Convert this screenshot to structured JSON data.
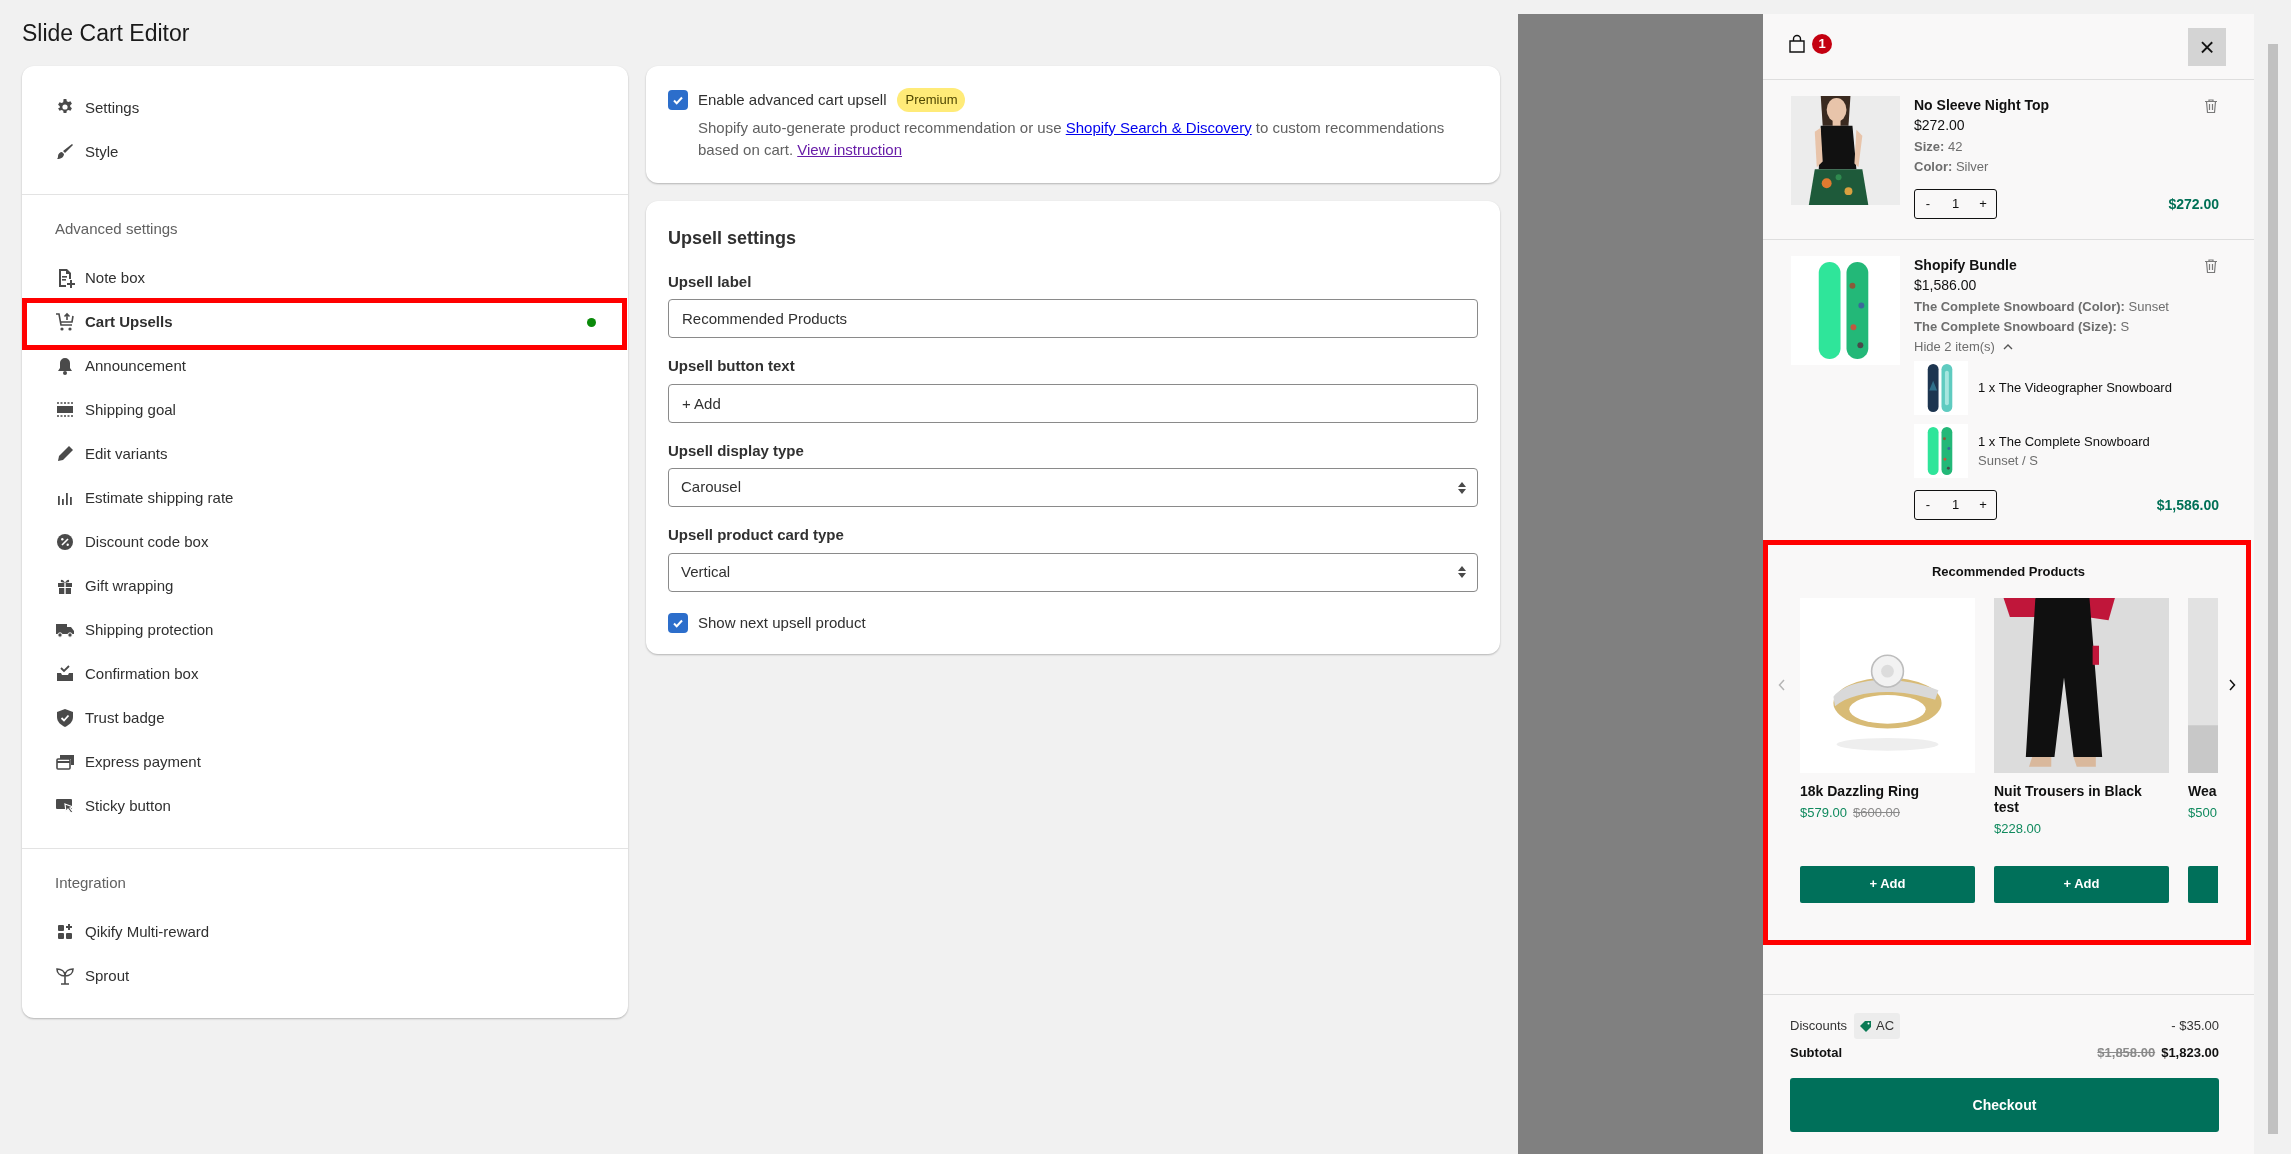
{
  "page_title": "Slide Cart Editor",
  "sidebar": {
    "sections": [
      {
        "items": [
          {
            "label": "Settings",
            "selected": false,
            "highlighted": false
          },
          {
            "label": "Style",
            "selected": false,
            "highlighted": false
          }
        ]
      },
      {
        "heading": "Advanced settings",
        "items": [
          {
            "label": "Note box",
            "selected": false,
            "highlighted": false
          },
          {
            "label": "Cart Upsells",
            "selected": true,
            "highlighted": true
          },
          {
            "label": "Announcement",
            "selected": false,
            "highlighted": false
          },
          {
            "label": "Shipping goal",
            "selected": false,
            "highlighted": false
          },
          {
            "label": "Edit variants",
            "selected": false,
            "highlighted": false
          },
          {
            "label": "Estimate shipping rate",
            "selected": false,
            "highlighted": false
          },
          {
            "label": "Discount code box",
            "selected": false,
            "highlighted": false
          },
          {
            "label": "Gift wrapping",
            "selected": false,
            "highlighted": false
          },
          {
            "label": "Shipping protection",
            "selected": false,
            "highlighted": false
          },
          {
            "label": "Confirmation box",
            "selected": false,
            "highlighted": false
          },
          {
            "label": "Trust badge",
            "selected": false,
            "highlighted": false
          },
          {
            "label": "Express payment",
            "selected": false,
            "highlighted": false
          },
          {
            "label": "Sticky button",
            "selected": false,
            "highlighted": false
          }
        ]
      },
      {
        "heading": "Integration",
        "items": [
          {
            "label": "Qikify Multi-reward",
            "selected": false,
            "highlighted": false
          },
          {
            "label": "Sprout",
            "selected": false,
            "highlighted": false
          }
        ]
      }
    ]
  },
  "enable_card": {
    "checkbox": {
      "label": "Enable advanced cart upsell",
      "checked": true
    },
    "badge": "Premium",
    "description": [
      {
        "kind": "text",
        "text": "Shopify auto-generate product recommendation or use "
      },
      {
        "kind": "link",
        "text": "Shopify Search & Discovery",
        "visited": false
      },
      {
        "kind": "text",
        "text": " to custom recommendations based on cart. "
      },
      {
        "kind": "link",
        "text": "View instruction",
        "visited": true
      }
    ]
  },
  "upsell_settings": {
    "title": "Upsell settings",
    "fields": [
      {
        "kind": "text",
        "label": "Upsell label",
        "value": "Recommended Products"
      },
      {
        "kind": "text",
        "label": "Upsell button text",
        "value": "+ Add"
      },
      {
        "kind": "select",
        "label": "Upsell display type",
        "value": "Carousel"
      },
      {
        "kind": "select",
        "label": "Upsell product card type",
        "value": "Vertical"
      }
    ],
    "checkbox": {
      "label": "Show next upsell product",
      "checked": true
    }
  },
  "cart": {
    "count": "1",
    "close": "×",
    "items": [
      {
        "name": "No Sleeve Night Top",
        "price": "$272.00",
        "options": [
          {
            "name": "Size:",
            "value": "42"
          },
          {
            "name": "Color:",
            "value": "Silver"
          }
        ],
        "quantity": "1",
        "decrement": "-",
        "increment": "+",
        "line_total": "$272.00"
      },
      {
        "name": "Shopify Bundle",
        "price": "$1,586.00",
        "options": [
          {
            "name": "The Complete Snowboard (Color):",
            "value": "Sunset"
          },
          {
            "name": "The Complete Snowboard (Size):",
            "value": "S"
          }
        ],
        "bundle_toggle": {
          "label": "Hide 2 item(s)",
          "expanded": true
        },
        "bundle_items": [
          {
            "label": "1 x The Videographer Snowboard"
          },
          {
            "label": "1 x The Complete Snowboard",
            "variant": "Sunset / S"
          }
        ],
        "quantity": "1",
        "decrement": "-",
        "increment": "+",
        "line_total": "$1,586.00"
      }
    ],
    "recommendations": {
      "title": "Recommended Products",
      "highlighted": true,
      "prev_disabled": true,
      "next_disabled": false,
      "products": [
        {
          "name": "18k Dazzling Ring",
          "price": "$579.00",
          "compare_price": "$600.00",
          "button": "+ Add"
        },
        {
          "name": "Nuit Trousers in Black test",
          "price": "$228.00",
          "button": "+ Add"
        },
        {
          "name": "Wea",
          "price": "$500"
        }
      ]
    },
    "discounts": {
      "label": "Discounts",
      "code": "AC",
      "amount": "- $35.00"
    },
    "subtotal": {
      "label": "Subtotal",
      "compare": "$1,858.00",
      "total": "$1,823.00"
    },
    "checkout": "Checkout"
  }
}
